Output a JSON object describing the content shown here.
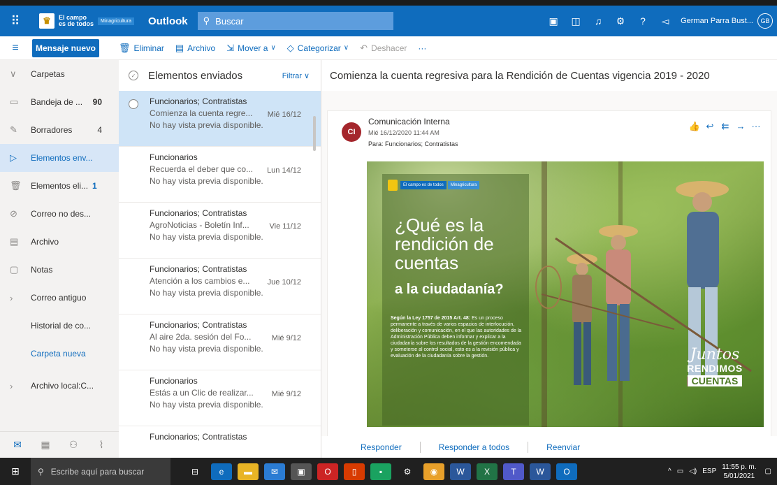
{
  "topbar": {
    "brand": "El campo es de todos",
    "ministry": "Minagricultura",
    "app_title": "Outlook",
    "search_placeholder": "Buscar",
    "user_name": "German Parra Bust...",
    "user_initials": "GB"
  },
  "commands": {
    "new_message": "Mensaje nuevo",
    "delete": "Eliminar",
    "archive": "Archivo",
    "move_to": "Mover a",
    "categorize": "Categorizar",
    "undo": "Deshacer",
    "more": "···"
  },
  "nav": {
    "folders_header": "Carpetas",
    "items": [
      {
        "label": "Bandeja de ...",
        "count": "90"
      },
      {
        "label": "Borradores",
        "count": "4"
      },
      {
        "label": "Elementos env..."
      },
      {
        "label": "Elementos eli...",
        "count": "1"
      },
      {
        "label": "Correo no des..."
      },
      {
        "label": "Archivo"
      },
      {
        "label": "Notas"
      },
      {
        "label": "Correo antiguo"
      },
      {
        "label": "Historial de co..."
      },
      {
        "label": "Carpeta nueva"
      },
      {
        "label": "Archivo local:C..."
      }
    ]
  },
  "list": {
    "title": "Elementos enviados",
    "filter": "Filtrar",
    "messages": [
      {
        "from": "Funcionarios; Contratistas",
        "subject": "Comienza la cuenta regre...",
        "preview": "No hay vista previa disponible.",
        "date": "Mié 16/12"
      },
      {
        "from": "Funcionarios",
        "subject": "Recuerda el deber que co...",
        "preview": "No hay vista previa disponible.",
        "date": "Lun 14/12"
      },
      {
        "from": "Funcionarios; Contratistas",
        "subject": "AgroNoticias - Boletín Inf...",
        "preview": "No hay vista previa disponible.",
        "date": "Vie 11/12"
      },
      {
        "from": "Funcionarios; Contratistas",
        "subject": "Atención a los cambios e...",
        "preview": "No hay vista previa disponible.",
        "date": "Jue 10/12"
      },
      {
        "from": "Funcionarios; Contratistas",
        "subject": "Al aire 2da. sesión del Fo...",
        "preview": "No hay vista previa disponible.",
        "date": "Mié 9/12"
      },
      {
        "from": "Funcionarios",
        "subject": "Estás a un Clic de realizar...",
        "preview": "No hay vista previa disponible.",
        "date": "Mié 9/12"
      },
      {
        "from": "Funcionarios; Contratistas",
        "subject": "",
        "preview": "",
        "date": ""
      }
    ]
  },
  "reading": {
    "subject": "Comienza la cuenta regresiva para la Rendición de Cuentas vigencia 2019 - 2020",
    "sender_initials": "CI",
    "sender": "Comunicación Interna",
    "date": "Mié 16/12/2020 11:44 AM",
    "to": "Para: Funcionarios; Contratistas",
    "poster": {
      "brand": "El campo es de todos",
      "ministry": "Minagricultura",
      "question": "¿Qué es la rendición de cuentas",
      "question_bold": "a la ciudadanía?",
      "law_title": "Según la Ley 1757 de 2015 Art. 48:",
      "law_text": "Es un proceso permanente a través de varios espacios de interlocución, deliberación y comunicación, en el que las autoridades de la Administración Pública deben informar y explicar a la ciudadanía sobre los resultados de la gestión encomendada y someterse al control social, esto es a la revisión pública y evaluación de la ciudadanía sobre la gestión.",
      "juntos": "Juntos",
      "rendimos": "RENDIMOS",
      "cuentas": "CUENTAS"
    },
    "reply": "Responder",
    "reply_all": "Responder a todos",
    "forward": "Reenviar"
  },
  "taskbar": {
    "search_placeholder": "Escribe aquí para buscar",
    "language": "ESP",
    "time": "11:55 p. m.",
    "date": "5/01/2021"
  }
}
